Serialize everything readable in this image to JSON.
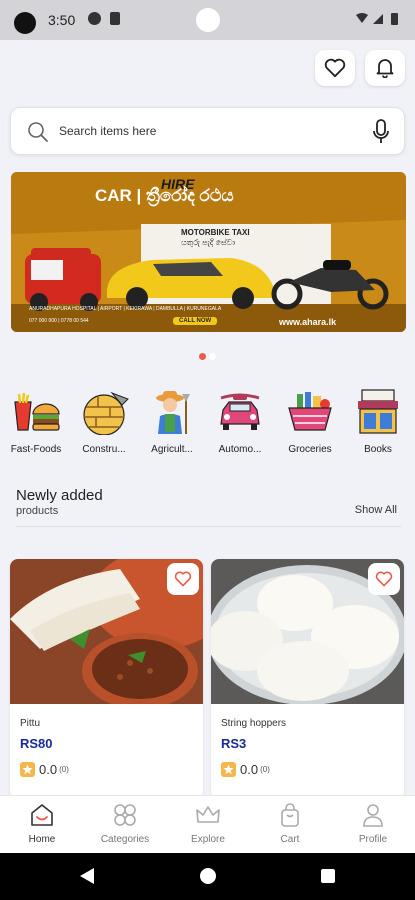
{
  "status_bar": {
    "time": "3:50"
  },
  "header": {
    "wishlist_icon": "heart-icon",
    "notifications_icon": "bell-icon"
  },
  "search": {
    "placeholder": "Search items here"
  },
  "banner": {
    "headline_1": "HIRE",
    "headline_2": "CAR | ත්‍රීරෝද රථය",
    "sub": "MOTORBIKE TAXI",
    "sub_si": "යතුරු පැදි සේවා",
    "footer_1": "ANURADHAPURA HOSPITAL | AIRPORT | KEKIRAWA | DAMBULLA | KURUNEGALA",
    "footer_2": "077 000 000 | 0778 00 544",
    "call_now": "CALL NOW",
    "website": "www.ahara.lk"
  },
  "carousel": {
    "active_index": 0,
    "count": 2,
    "active_color": "#ef5a4e",
    "inactive_color": "#ffffff"
  },
  "categories": [
    {
      "label": "Fast-Foods",
      "icon": "fast-food-icon"
    },
    {
      "label": "Constru...",
      "icon": "construction-icon"
    },
    {
      "label": "Agricult...",
      "icon": "farmer-icon"
    },
    {
      "label": "Automo...",
      "icon": "car-icon"
    },
    {
      "label": "Groceries",
      "icon": "grocery-basket-icon"
    },
    {
      "label": "Books",
      "icon": "bookshop-icon"
    }
  ],
  "section": {
    "title": "Newly added",
    "subtitle": "products",
    "show_all": "Show All"
  },
  "products": [
    {
      "name": "Pittu",
      "price": "RS80",
      "rating": "0.0",
      "rating_count": "(0)"
    },
    {
      "name": "String hoppers",
      "price": "RS3",
      "rating": "0.0",
      "rating_count": "(0)"
    }
  ],
  "bottom_nav": [
    {
      "label": "Home",
      "icon": "home-icon"
    },
    {
      "label": "Categories",
      "icon": "categories-icon"
    },
    {
      "label": "Explore",
      "icon": "crown-icon"
    },
    {
      "label": "Cart",
      "icon": "cart-bag-icon"
    },
    {
      "label": "Profile",
      "icon": "profile-icon"
    }
  ],
  "colors": {
    "price": "#1a2a9c",
    "accent": "#ef5a4e",
    "banner_bg": "#c98a17"
  }
}
